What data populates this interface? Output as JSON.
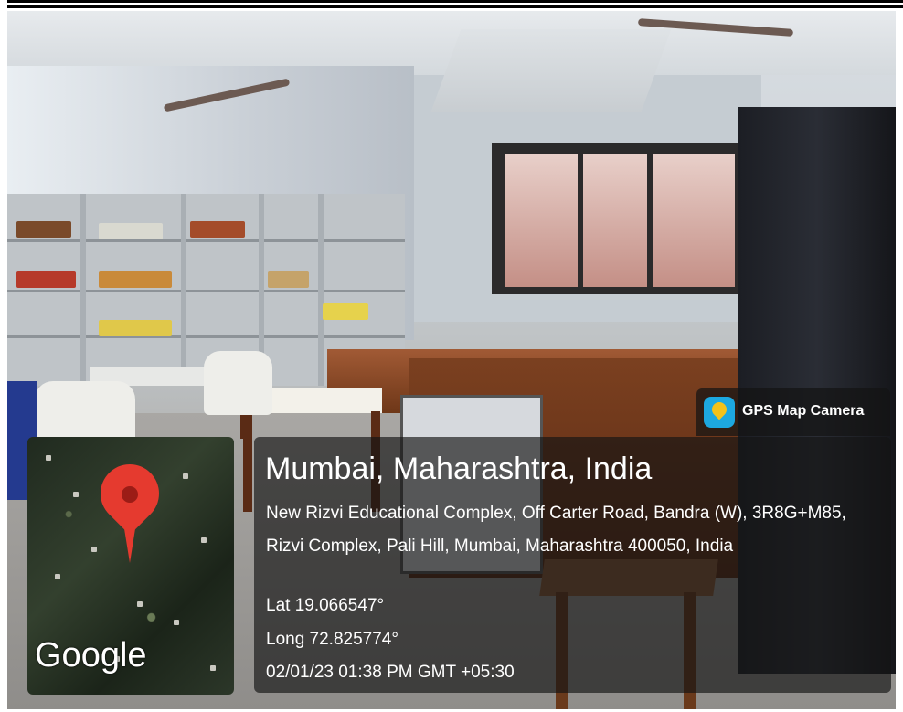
{
  "badge": {
    "label": "GPS Map Camera",
    "icon": "gps-map-camera-icon"
  },
  "map": {
    "attribution": "Google",
    "marker_icon": "location-pin-icon"
  },
  "location": {
    "title": "Mumbai, Maharashtra, India",
    "address": "New Rizvi Educational Complex, Off Carter Road, Bandra (W), 3R8G+M85, Rizvi Complex, Pali Hill, Mumbai, Maharashtra 400050, India",
    "lat": "Lat 19.066547°",
    "long": "Long 72.825774°",
    "datetime": "02/01/23 01:38 PM GMT +05:30"
  },
  "colors": {
    "overlay": "#141414",
    "pin": "#e53a2f",
    "badge_icon": "#1da8e0"
  }
}
